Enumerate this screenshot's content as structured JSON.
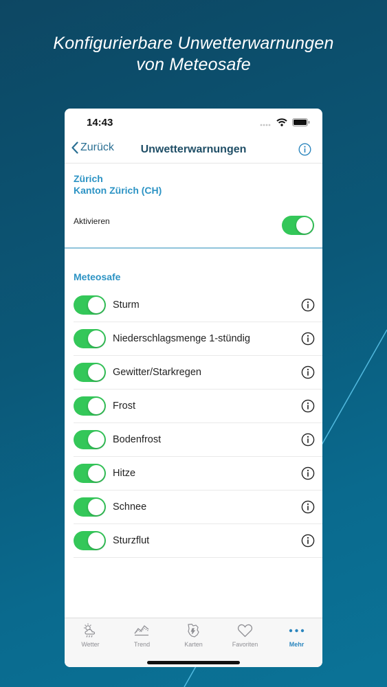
{
  "promo": {
    "line1": "Konfigurierbare Unwetterwarnungen",
    "line2": "von Meteosafe"
  },
  "status_bar": {
    "time": "14:43"
  },
  "nav": {
    "back_label": "Zurück",
    "title": "Unwetterwarnungen",
    "info_icon": "info-circle-icon"
  },
  "location": {
    "city": "Zürich",
    "region": "Kanton Zürich (CH)"
  },
  "activate": {
    "label": "Aktivieren",
    "enabled": true
  },
  "section": {
    "title": "Meteosafe"
  },
  "warnings": [
    {
      "label": "Sturm",
      "enabled": true
    },
    {
      "label": "Niederschlagsmenge 1-stündig",
      "enabled": true
    },
    {
      "label": "Gewitter/Starkregen",
      "enabled": true
    },
    {
      "label": "Frost",
      "enabled": true
    },
    {
      "label": "Bodenfrost",
      "enabled": true
    },
    {
      "label": "Hitze",
      "enabled": true
    },
    {
      "label": "Schnee",
      "enabled": true
    },
    {
      "label": "Sturzflut",
      "enabled": true
    }
  ],
  "tabs": [
    {
      "label": "Wetter",
      "icon": "weather-icon",
      "active": false
    },
    {
      "label": "Trend",
      "icon": "trend-icon",
      "active": false
    },
    {
      "label": "Karten",
      "icon": "map-icon",
      "active": false
    },
    {
      "label": "Favoriten",
      "icon": "heart-icon",
      "active": false
    },
    {
      "label": "Mehr",
      "icon": "more-icon",
      "active": true
    }
  ],
  "colors": {
    "accent": "#2c93c4",
    "toggle_on": "#34c759",
    "nav_title": "#1f4e66",
    "background": "#0b5878"
  }
}
